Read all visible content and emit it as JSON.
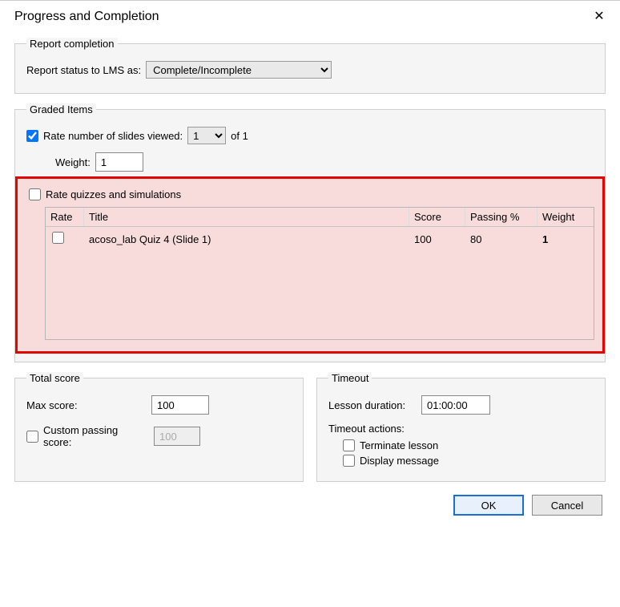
{
  "window": {
    "title": "Progress and Completion"
  },
  "report_completion": {
    "legend": "Report completion",
    "label": "Report status to LMS as:",
    "selected": "Complete/Incomplete"
  },
  "graded_items": {
    "legend": "Graded Items",
    "rate_slides_label": "Rate number of slides viewed:",
    "rate_slides_value": "1",
    "rate_slides_of": "of 1",
    "weight_label": "Weight:",
    "weight_value": "1",
    "rate_quizzes_label": "Rate quizzes and simulations",
    "columns": {
      "rate": "Rate",
      "title": "Title",
      "score": "Score",
      "passing": "Passing %",
      "weight": "Weight"
    },
    "rows": [
      {
        "rate_checked": false,
        "title": "acoso_lab Quiz 4 (Slide 1)",
        "score": "100",
        "passing": "80",
        "weight": "1"
      }
    ]
  },
  "total_score": {
    "legend": "Total score",
    "max_label": "Max score:",
    "max_value": "100",
    "custom_label": "Custom passing score:",
    "custom_value": "100"
  },
  "timeout": {
    "legend": "Timeout",
    "duration_label": "Lesson duration:",
    "duration_value": "01:00:00",
    "actions_label": "Timeout actions:",
    "terminate_label": "Terminate lesson",
    "display_label": "Display message"
  },
  "buttons": {
    "ok": "OK",
    "cancel": "Cancel"
  }
}
